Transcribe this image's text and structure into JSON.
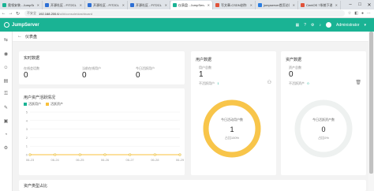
{
  "browser": {
    "tabs": [
      {
        "label": "奥领安装 - JumpServ",
        "color": "#1ab394",
        "active": false
      },
      {
        "label": "开源社区 - FIT2CLO",
        "color": "#2d6fd4",
        "active": false
      },
      {
        "label": "开源社区 - FIT2CLO",
        "color": "#2d6fd4",
        "active": false
      },
      {
        "label": "开源社区 - FIT2CLO",
        "color": "#2d6fd4",
        "active": false
      },
      {
        "label": "仪表盘 - JumpServe",
        "color": "#1ab394",
        "active": true
      },
      {
        "label": "写文章-CSDN创作中",
        "color": "#e0533a",
        "active": false
      },
      {
        "label": "jumpserver首页访问",
        "color": "#2a7de1",
        "active": false
      },
      {
        "label": "CentOS 7系统下进行",
        "color": "#e0533a",
        "active": false
      }
    ],
    "warning": "不安全",
    "url_host": "192.168.200.6",
    "url_path": "/ui/#/console/dashboard"
  },
  "header": {
    "app_name": "JumpServer",
    "user": "Administrator"
  },
  "page": {
    "title": "仪表盘"
  },
  "realtime": {
    "title": "实时数据",
    "stats": [
      {
        "label": "在线会话数",
        "value": "0"
      },
      {
        "label": "当前在线用户",
        "value": "0"
      },
      {
        "label": "今日活跃用户",
        "value": "0"
      }
    ]
  },
  "trend": {
    "title": "用户资产活跃情况",
    "legend": [
      {
        "label": "活跃用户",
        "color": "#1ab394"
      },
      {
        "label": "活跃资产",
        "color": "#f8c13c"
      }
    ]
  },
  "users": {
    "title": "用户数据",
    "count_label": "用户总数",
    "count": "1",
    "inactive_label": "不活跃用户",
    "inactive": "1",
    "ring_label": "今日活动用户数",
    "ring_value": "1",
    "ring_percent": "占比100%",
    "ring_fraction": 1.0,
    "ring_color": "#f8c54a"
  },
  "assets": {
    "title": "资产数据",
    "count_label": "资产总数",
    "count": "0",
    "inactive_label": "不活跃资产",
    "inactive": "0",
    "ring_label": "今日活跃资产数",
    "ring_value": "0",
    "ring_percent": "占比0%",
    "ring_fraction": 0,
    "ring_color": "#e8eceb"
  },
  "asset_types": {
    "title": "资产类型占比"
  },
  "chart_data": {
    "type": "line",
    "x": [
      "06-23",
      "06-24",
      "06-25",
      "06-26",
      "06-27",
      "06-28",
      "06-29"
    ],
    "ylim": [
      0,
      5
    ],
    "yticks": [
      "5",
      "4",
      "3",
      "2",
      "1",
      "0"
    ],
    "series": [
      {
        "name": "活跃用户",
        "values": [
          0,
          0,
          0,
          0,
          0,
          0,
          0
        ],
        "color": "#1ab394"
      },
      {
        "name": "活跃资产",
        "values": [
          0,
          0,
          0,
          0,
          0,
          0,
          0
        ],
        "color": "#f8c13c"
      }
    ]
  }
}
